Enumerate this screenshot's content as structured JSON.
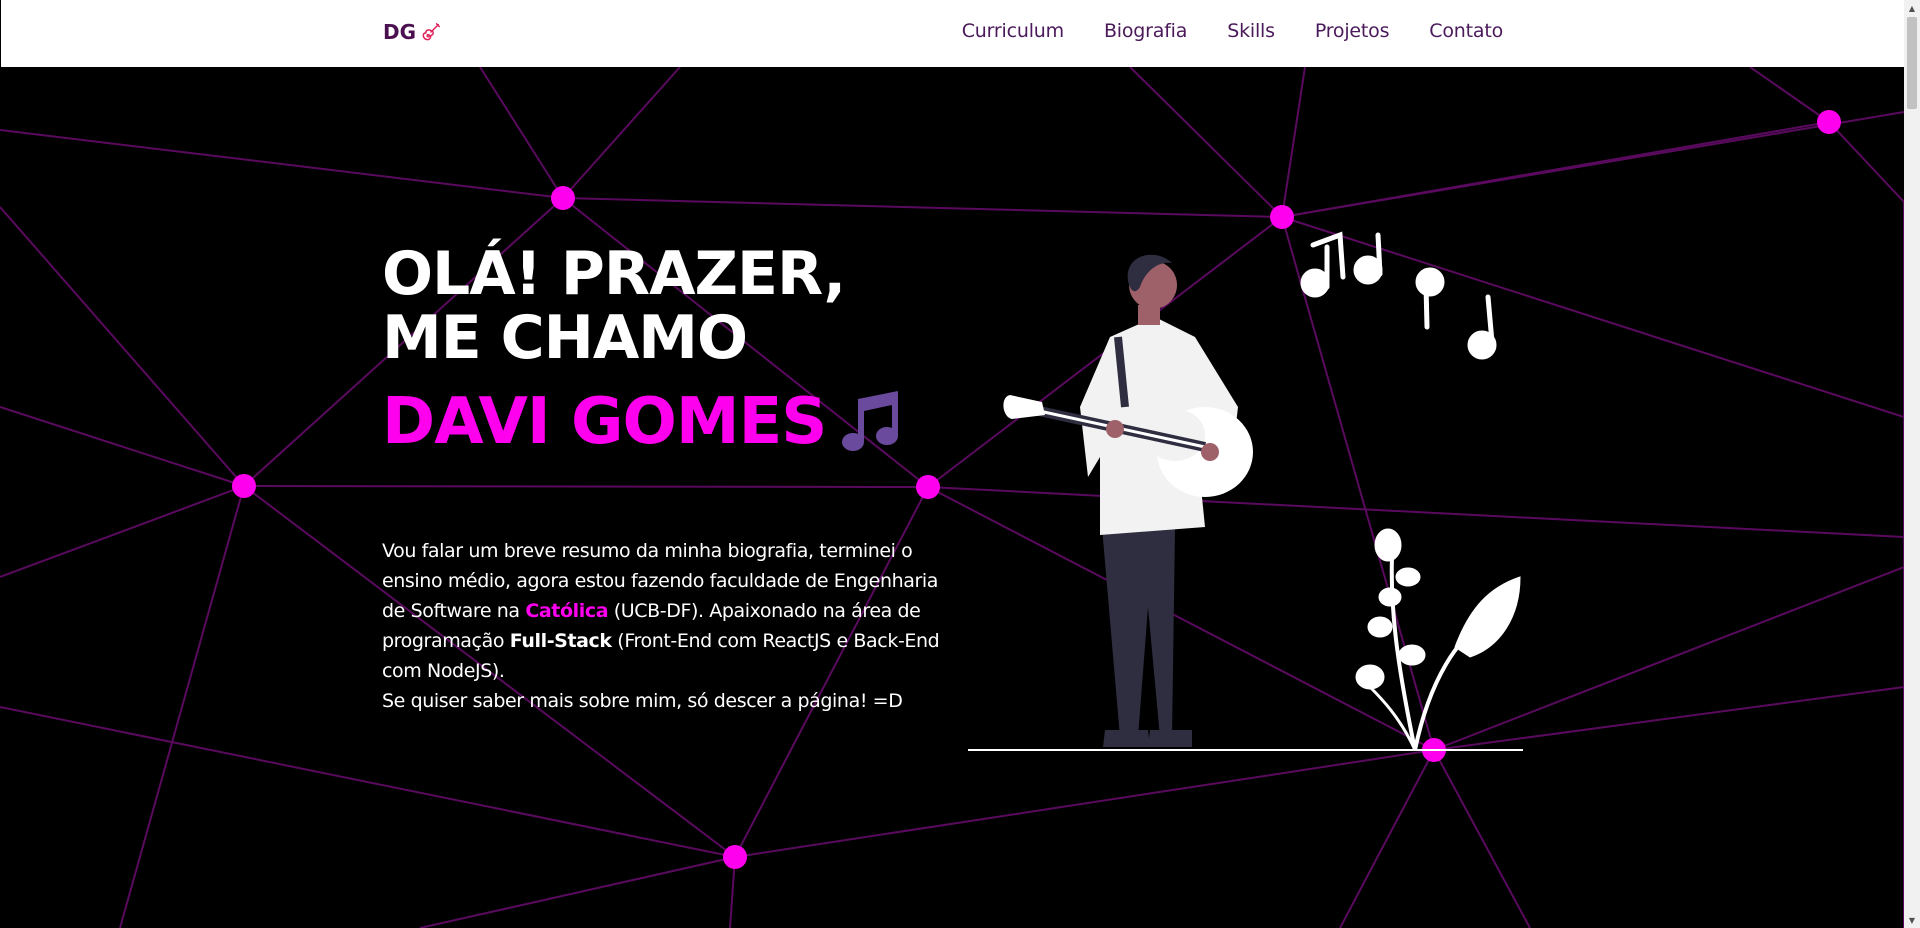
{
  "header": {
    "brand": "DG",
    "nav": [
      "Curriculum",
      "Biografia",
      "Skills",
      "Projetos",
      "Contato"
    ]
  },
  "hero": {
    "heading_line1": "OLÁ! PRAZER,",
    "heading_line2": "ME CHAMO",
    "name": "DAVI GOMES",
    "bio": {
      "p1": "Vou falar um breve resumo da minha biografia, terminei o ensino médio, agora estou fazendo faculdade de Engenharia de Software na ",
      "highlight": "Católica",
      "p2": " (UCB-DF). Apaixonado na área de programação ",
      "strong": "Full-Stack",
      "p3": " (Front-End com ReactJS e Back-End com NodeJS).",
      "p4": "Se quiser saber mais sobre mim, só descer a página! =D"
    }
  },
  "icons": {
    "brand_icon": "guitar-icon",
    "name_icon": "music-note-icon"
  },
  "colors": {
    "accent": "#ff00ee",
    "network_line": "#5a0a5e",
    "background": "#000000",
    "nav_text": "#4a1a5a"
  }
}
